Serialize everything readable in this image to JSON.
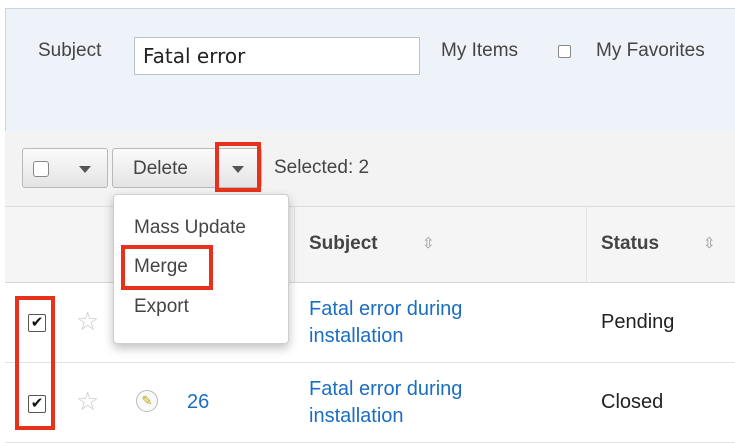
{
  "filter": {
    "subject_label": "Subject",
    "subject_value": "Fatal error",
    "my_items_label": "My Items",
    "my_favorites_label": "My Favorites"
  },
  "toolbar": {
    "delete_label": "Delete",
    "selected_text": "Selected: 2"
  },
  "dropdown": {
    "items": [
      "Mass Update",
      "Merge",
      "Export"
    ]
  },
  "table": {
    "columns": [
      "Subject",
      "Status"
    ],
    "rows": [
      {
        "number": "",
        "subject": "Fatal error during installation",
        "status": "Pending",
        "checked": "✔"
      },
      {
        "number": "26",
        "subject": "Fatal error during installation",
        "status": "Closed",
        "checked": "✔"
      }
    ]
  },
  "colors": {
    "highlight": "#e8311a",
    "link": "#1b6ec2",
    "panel": "#eef3fa"
  }
}
